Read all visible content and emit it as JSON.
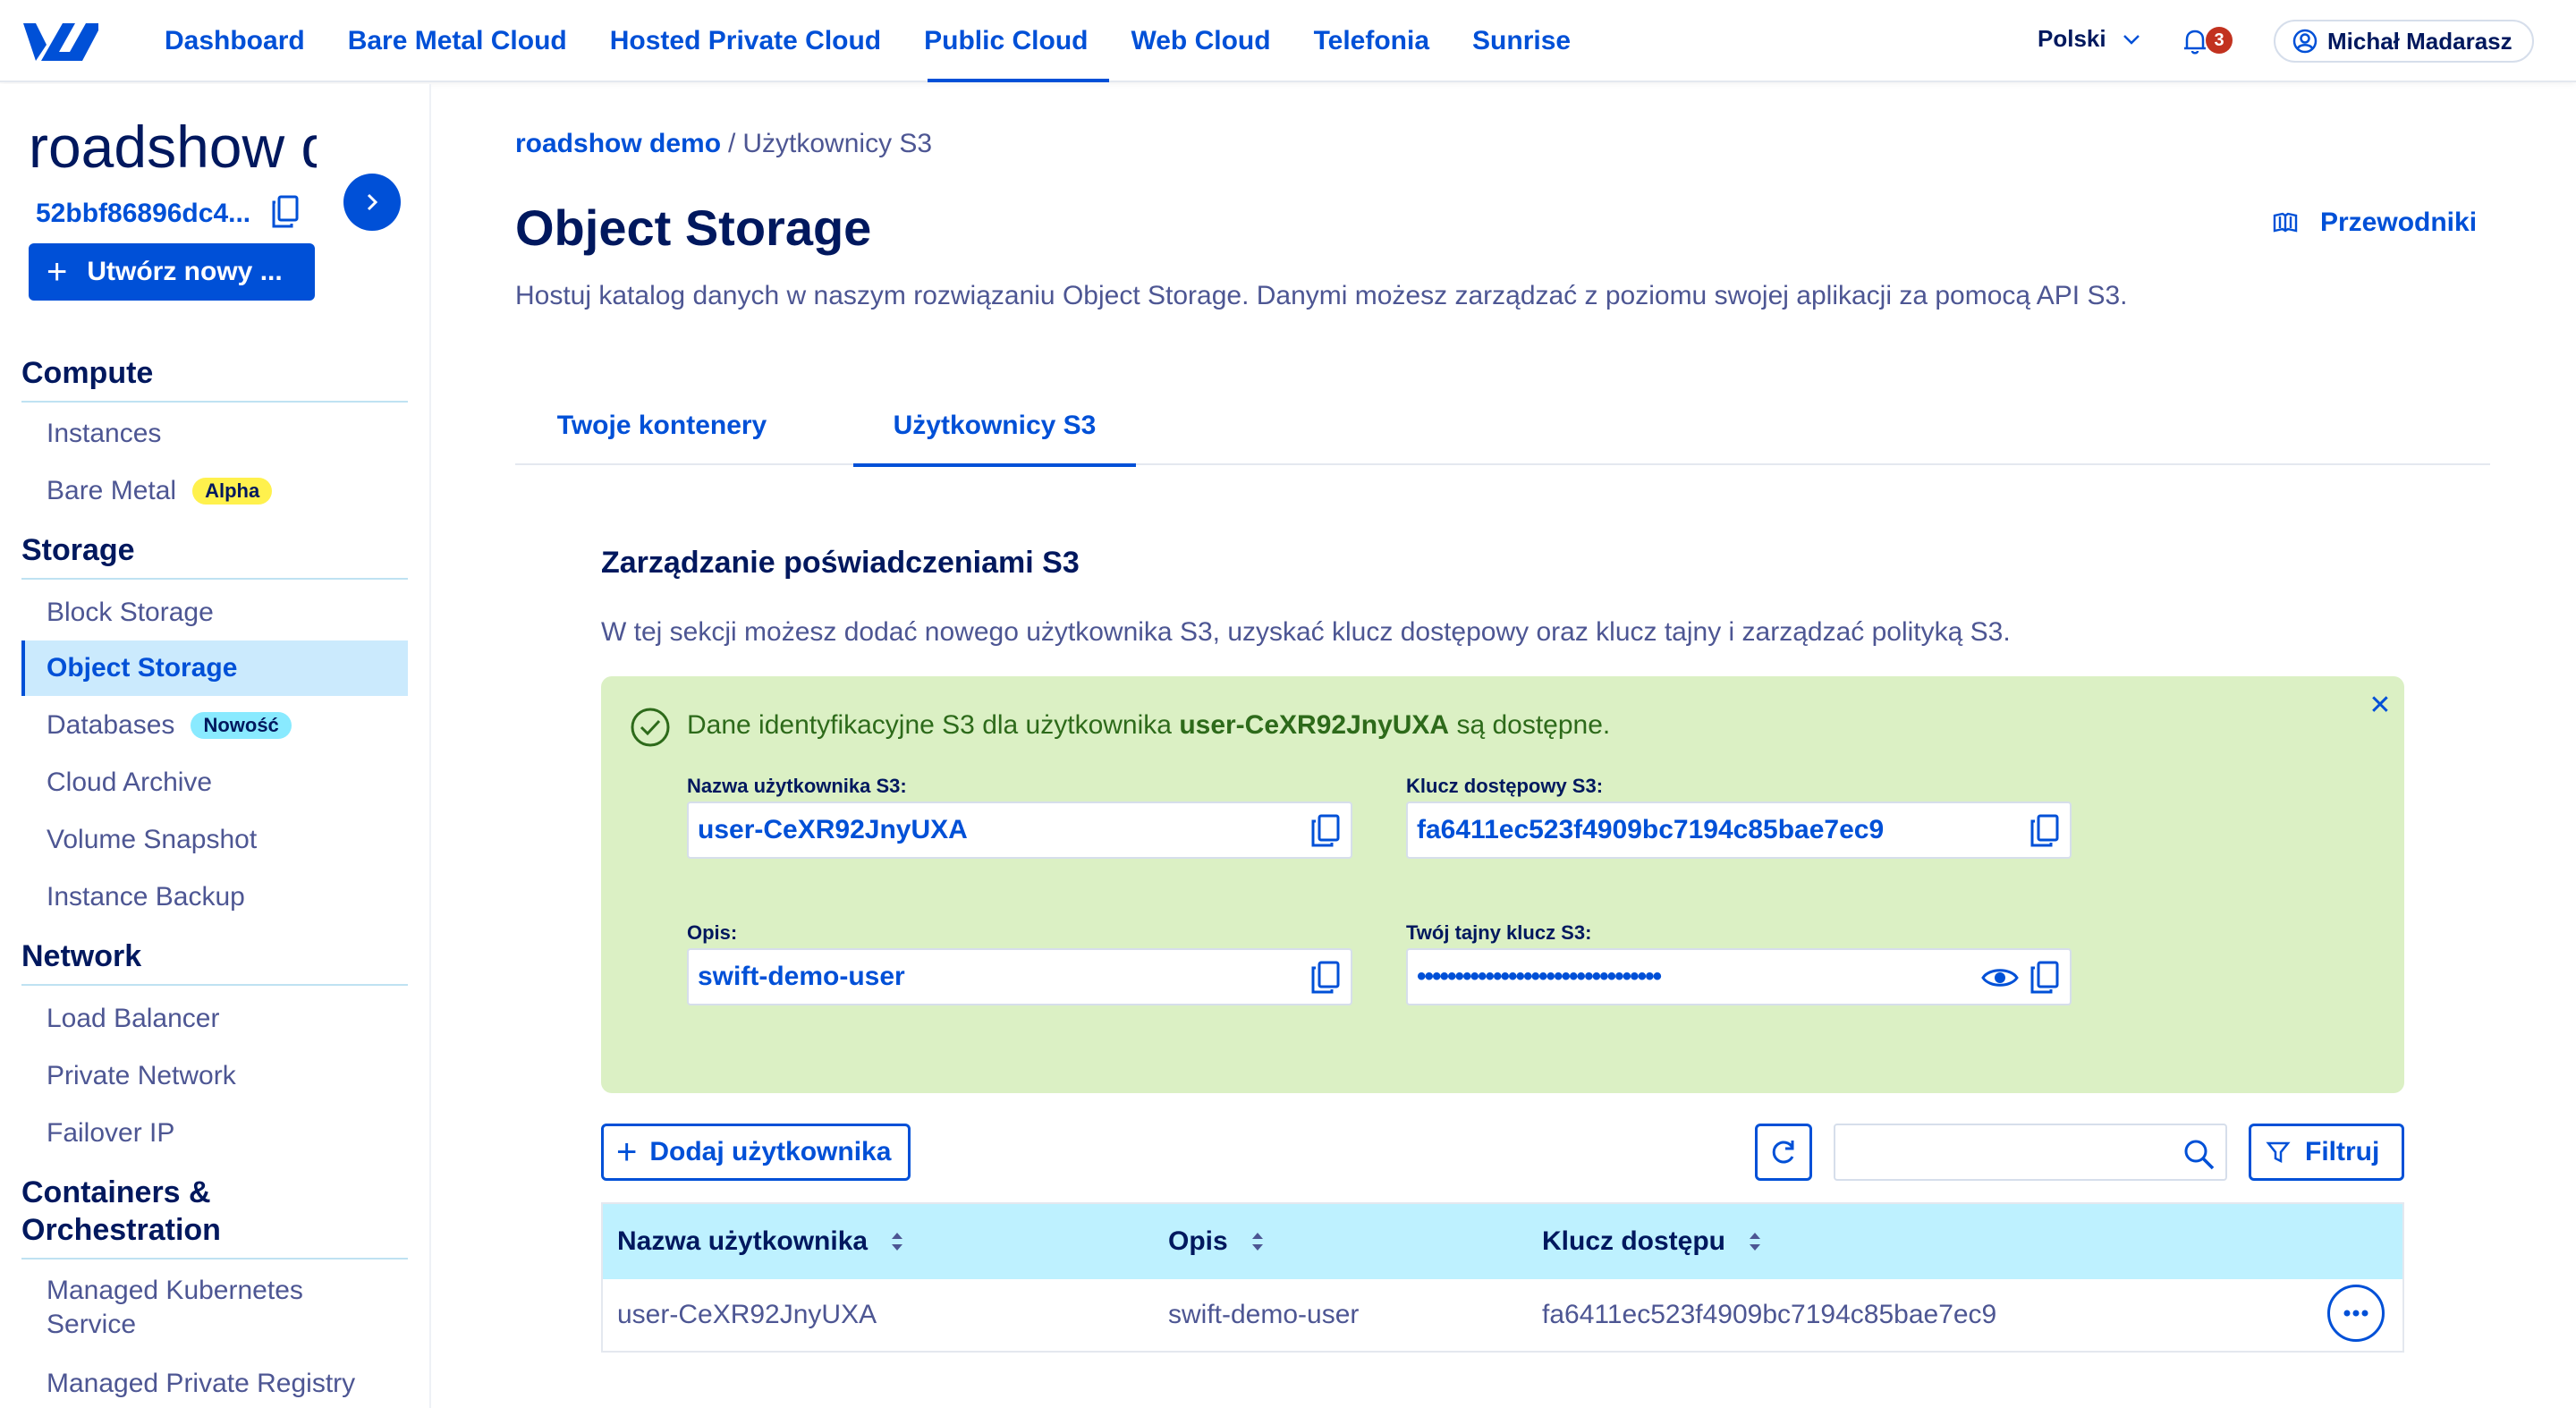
{
  "topnav": {
    "items": [
      "Dashboard",
      "Bare Metal Cloud",
      "Hosted Private Cloud",
      "Public Cloud",
      "Web Cloud",
      "Telefonia",
      "Sunrise"
    ],
    "active_index": 3,
    "language": "Polski",
    "notification_count": "3",
    "user_name": "Michał Madarasz"
  },
  "sidebar": {
    "project_title": "roadshow demo",
    "project_id": "52bbf86896dc4...",
    "create_label": "Utwórz nowy ...",
    "sections": [
      {
        "title": "Compute",
        "items": [
          {
            "label": "Instances"
          },
          {
            "label": "Bare Metal",
            "badge": "Alpha"
          }
        ]
      },
      {
        "title": "Storage",
        "items": [
          {
            "label": "Block Storage"
          },
          {
            "label": "Object Storage",
            "active": true
          },
          {
            "label": "Databases",
            "badge": "Nowość"
          },
          {
            "label": "Cloud Archive"
          },
          {
            "label": "Volume Snapshot"
          },
          {
            "label": "Instance Backup"
          }
        ]
      },
      {
        "title": "Network",
        "items": [
          {
            "label": "Load Balancer"
          },
          {
            "label": "Private Network"
          },
          {
            "label": "Failover IP"
          }
        ]
      },
      {
        "title": "Containers & Orchestration",
        "items": [
          {
            "label": "Managed Kubernetes Service"
          },
          {
            "label": "Managed Private Registry"
          }
        ]
      }
    ]
  },
  "main": {
    "breadcrumb": {
      "link": "roadshow demo",
      "separator": "/",
      "current": "Użytkownicy S3"
    },
    "title": "Object Storage",
    "guides_label": "Przewodniki",
    "description": "Hostuj katalog danych w naszym rozwiązaniu Object Storage. Danymi możesz zarządzać z poziomu swojej aplikacji za pomocą API S3.",
    "tabs": [
      "Twoje kontenery",
      "Użytkownicy S3"
    ],
    "active_tab": 1,
    "section_title": "Zarządzanie poświadczeniami S3",
    "section_description": "W tej sekcji możesz dodać nowego użytkownika S3, uzyskać klucz dostępowy oraz klucz tajny i zarządzać polityką S3.",
    "success": {
      "prefix": "Dane identyfikacyjne S3 dla użytkownika ",
      "user": "user-CeXR92JnyUXA",
      "suffix": " są dostępne.",
      "fields": {
        "username_label": "Nazwa użytkownika S3:",
        "username_value": "user-CeXR92JnyUXA",
        "access_key_label": "Klucz dostępowy S3:",
        "access_key_value": "fa6411ec523f4909bc7194c85bae7ec9",
        "description_label": "Opis:",
        "description_value": "swift-demo-user",
        "secret_label": "Twój tajny klucz S3:",
        "secret_value": "••••••••••••••••••••••••••••••••"
      }
    },
    "toolbar": {
      "add_user_label": "Dodaj użytkownika",
      "search_placeholder": "",
      "filter_label": "Filtruj"
    },
    "table": {
      "headers": [
        "Nazwa użytkownika",
        "Opis",
        "Klucz dostępu"
      ],
      "rows": [
        [
          "user-CeXR92JnyUXA",
          "swift-demo-user",
          "fa6411ec523f4909bc7194c85bae7ec9"
        ]
      ]
    }
  },
  "colors": {
    "primary": "#0050d7",
    "navy": "#00185e",
    "success_bg": "#dbf0c4",
    "table_header_bg": "#bef1ff",
    "active_side_bg": "#cbeafd"
  }
}
